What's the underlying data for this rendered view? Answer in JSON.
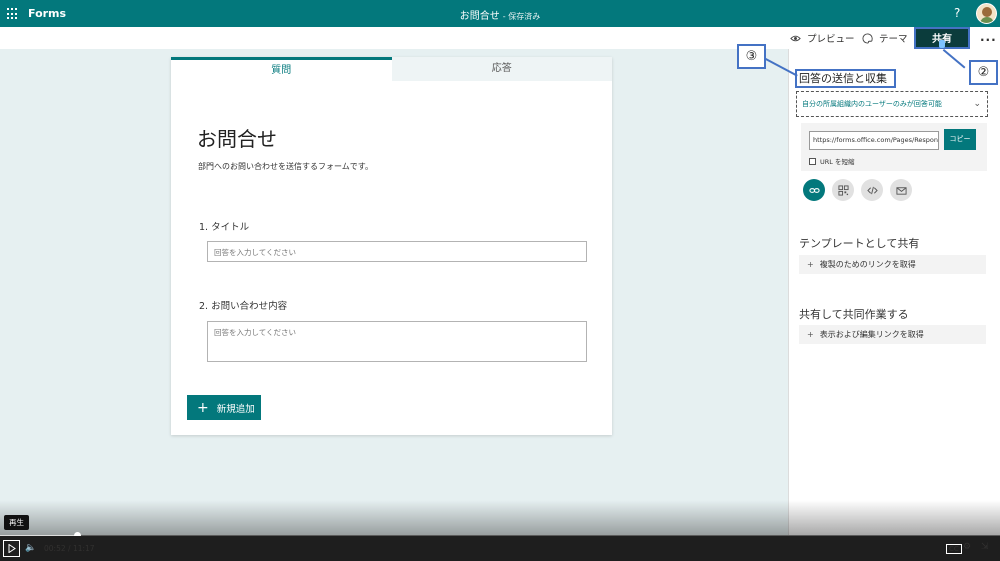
{
  "topbar": {
    "brand": "Forms",
    "doc_title": "お問合せ",
    "saved_status": "- 保存済み",
    "help": "?"
  },
  "commands": {
    "preview_label": "プレビュー",
    "theme_label": "テーマ",
    "share_label": "共有",
    "more_label": "..."
  },
  "form": {
    "tabs": [
      {
        "label": "質問",
        "active": true
      },
      {
        "label": "応答",
        "active": false
      }
    ],
    "title": "お問合せ",
    "description": "部門へのお問い合わせを送信するフォームです。",
    "questions": [
      {
        "label": "1. タイトル",
        "placeholder": "回答を入力してください"
      },
      {
        "label": "2. お問い合わせ内容",
        "placeholder": "回答を入力してください"
      }
    ],
    "add_button": "新規追加"
  },
  "share_panel": {
    "heading": "回答の送信と収集",
    "scope": "自分の所属組織内のユーザーのみが回答可能",
    "url": "https://forms.office.com/Pages/ResponsePage.aspx",
    "copy_label": "コピー",
    "shorten_label": "URL を短縮",
    "share_icons": [
      "link-icon",
      "qr-code-icon",
      "embed-icon",
      "mail-icon"
    ],
    "template_heading": "テンプレートとして共有",
    "template_button": "複製のためのリンクを取得",
    "collab_heading": "共有して共同作業する",
    "collab_button": "表示および編集リンクを取得"
  },
  "annotations": {
    "callout_2": "②",
    "callout_3": "③",
    "color": "#4472c4"
  },
  "player": {
    "tooltip": "再生",
    "current_time": "00:52",
    "separator": "/",
    "duration": "11:17",
    "progress_fraction": 0.077
  },
  "colors": {
    "accent": "#03787c",
    "share_button": "#0b3c3c",
    "background": "#e6f0f1"
  }
}
